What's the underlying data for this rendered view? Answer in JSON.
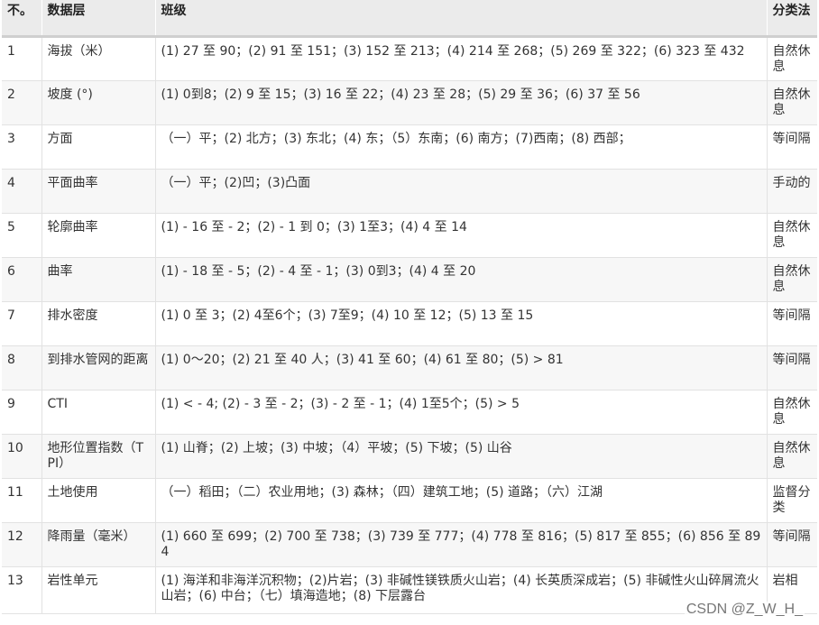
{
  "table": {
    "headers": [
      "不。",
      "数据层",
      "班级",
      "分类法"
    ],
    "rows": [
      {
        "no": "1",
        "layer": "海拔（米）",
        "classes": "(1) 27 至 90；(2) 91 至 151；(3) 152 至 213；(4) 214 至 268；(5) 269 至 322；(6) 323 至 432",
        "method": "自然休息"
      },
      {
        "no": "2",
        "layer": "坡度 (°)",
        "classes": "(1) 0到8；(2) 9 至 15；(3) 16 至 22；(4) 23 至 28；(5) 29 至 36；(6) 37 至 56",
        "method": "自然休息"
      },
      {
        "no": "3",
        "layer": "方面",
        "classes": "（一）平；(2) 北方；(3) 东北；(4) 东；（5）东南；(6) 南方；(7)西南；(8) 西部；",
        "method": "等间隔"
      },
      {
        "no": "4",
        "layer": "平面曲率",
        "classes": "（一）平；(2)凹；(3)凸面",
        "method": "手动的"
      },
      {
        "no": "5",
        "layer": "轮廓曲率",
        "classes": "(1) - 16 至 - 2；(2) - 1 到 0；(3) 1至3；(4) 4 至 14",
        "method": "自然休息"
      },
      {
        "no": "6",
        "layer": "曲率",
        "classes": "(1) - 18 至 - 5；(2) - 4 至 - 1；(3) 0到3；(4) 4 至 20",
        "method": "自然休息"
      },
      {
        "no": "7",
        "layer": "排水密度",
        "classes": "(1) 0 至 3；(2) 4至6个；(3) 7至9；(4) 10 至 12；(5) 13 至 15",
        "method": "等间隔"
      },
      {
        "no": "8",
        "layer": "到排水管网的距离",
        "classes": "(1) 0～20；(2) 21 至 40 人；(3) 41 至 60；(4) 61 至 80；(5) > 81",
        "method": "等间隔"
      },
      {
        "no": "9",
        "layer": "CTI",
        "classes": "(1) < - 4; (2) - 3 至 - 2；(3) - 2 至 - 1；(4) 1至5个；(5) > 5",
        "method": "自然休息"
      },
      {
        "no": "10",
        "layer": "地形位置指数（TPI）",
        "classes": "(1) 山脊；(2) 上坡；(3) 中坡；（4）平坡；(5) 下坡；(5) 山谷",
        "method": "自然休息"
      },
      {
        "no": "11",
        "layer": "土地使用",
        "classes": "（一）稻田；（二）农业用地；(3) 森林；（四）建筑工地；(5) 道路；（六）江湖",
        "method": "监督分类"
      },
      {
        "no": "12",
        "layer": "降雨量（毫米）",
        "classes": "(1) 660 至 699；(2) 700 至 738；(3) 739 至 777；(4) 778 至 816；(5) 817 至 855；(6) 856 至 894",
        "method": "等间隔"
      },
      {
        "no": "13",
        "layer": "岩性单元",
        "classes": "(1) 海洋和非海洋沉积物；(2)片岩；(3) 非碱性镁铁质火山岩；(4) 长英质深成岩；(5) 非碱性火山碎屑流火山岩；(6) 中台；（七）填海造地；(8) 下层露台",
        "method": "岩相"
      }
    ]
  },
  "watermark": "CSDN @Z_W_H_"
}
